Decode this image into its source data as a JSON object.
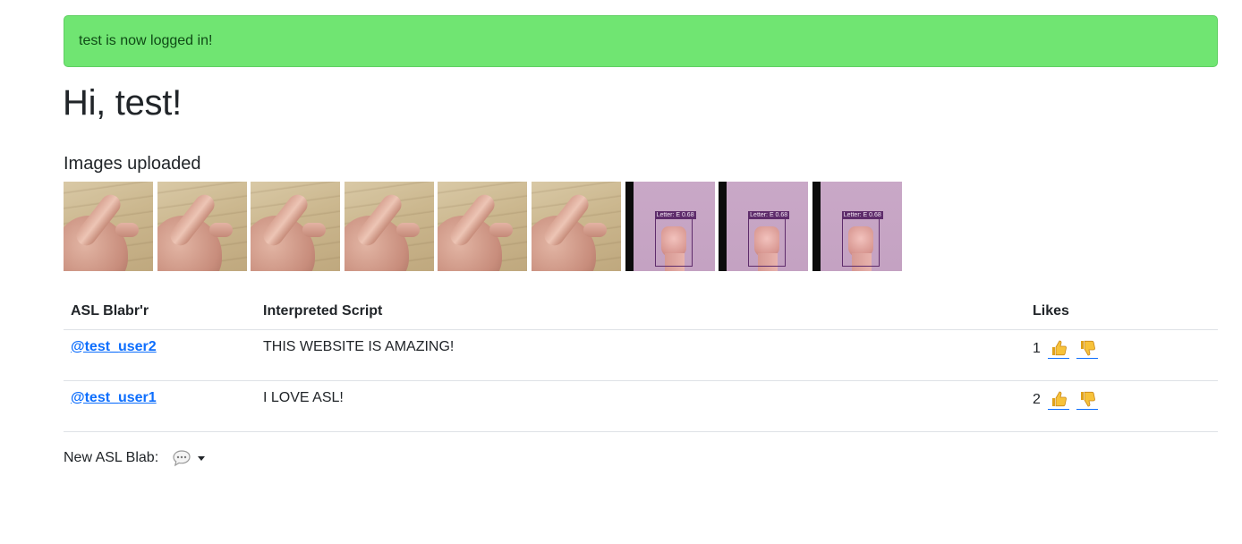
{
  "alert": {
    "message": "test is now logged in!",
    "color": "#70e572"
  },
  "greeting": "Hi, test!",
  "images_section": {
    "title": "Images uploaded",
    "images": [
      {
        "kind": "hand"
      },
      {
        "kind": "hand"
      },
      {
        "kind": "hand"
      },
      {
        "kind": "hand"
      },
      {
        "kind": "hand"
      },
      {
        "kind": "hand"
      },
      {
        "kind": "detect",
        "label": "Letter: E 0.68"
      },
      {
        "kind": "detect",
        "label": "Letter: E 0.68"
      },
      {
        "kind": "detect",
        "label": "Letter: E 0.68"
      }
    ]
  },
  "feed": {
    "headers": {
      "user": "ASL Blabr'r",
      "script": "Interpreted Script",
      "likes": "Likes"
    },
    "rows": [
      {
        "user": "@test_user2",
        "script": "THIS WEBSITE IS AMAZING!",
        "likes": "1"
      },
      {
        "user": "@test_user1",
        "script": "I LOVE ASL!",
        "likes": "2"
      }
    ],
    "icons": {
      "upvote": "thumbs-up-icon",
      "downvote": "thumbs-down-icon"
    }
  },
  "new_blab": {
    "label": "New ASL Blab:",
    "icon": "speech-bubble-icon"
  },
  "colors": {
    "link": "#0d6efd",
    "border": "#dee2e6"
  }
}
